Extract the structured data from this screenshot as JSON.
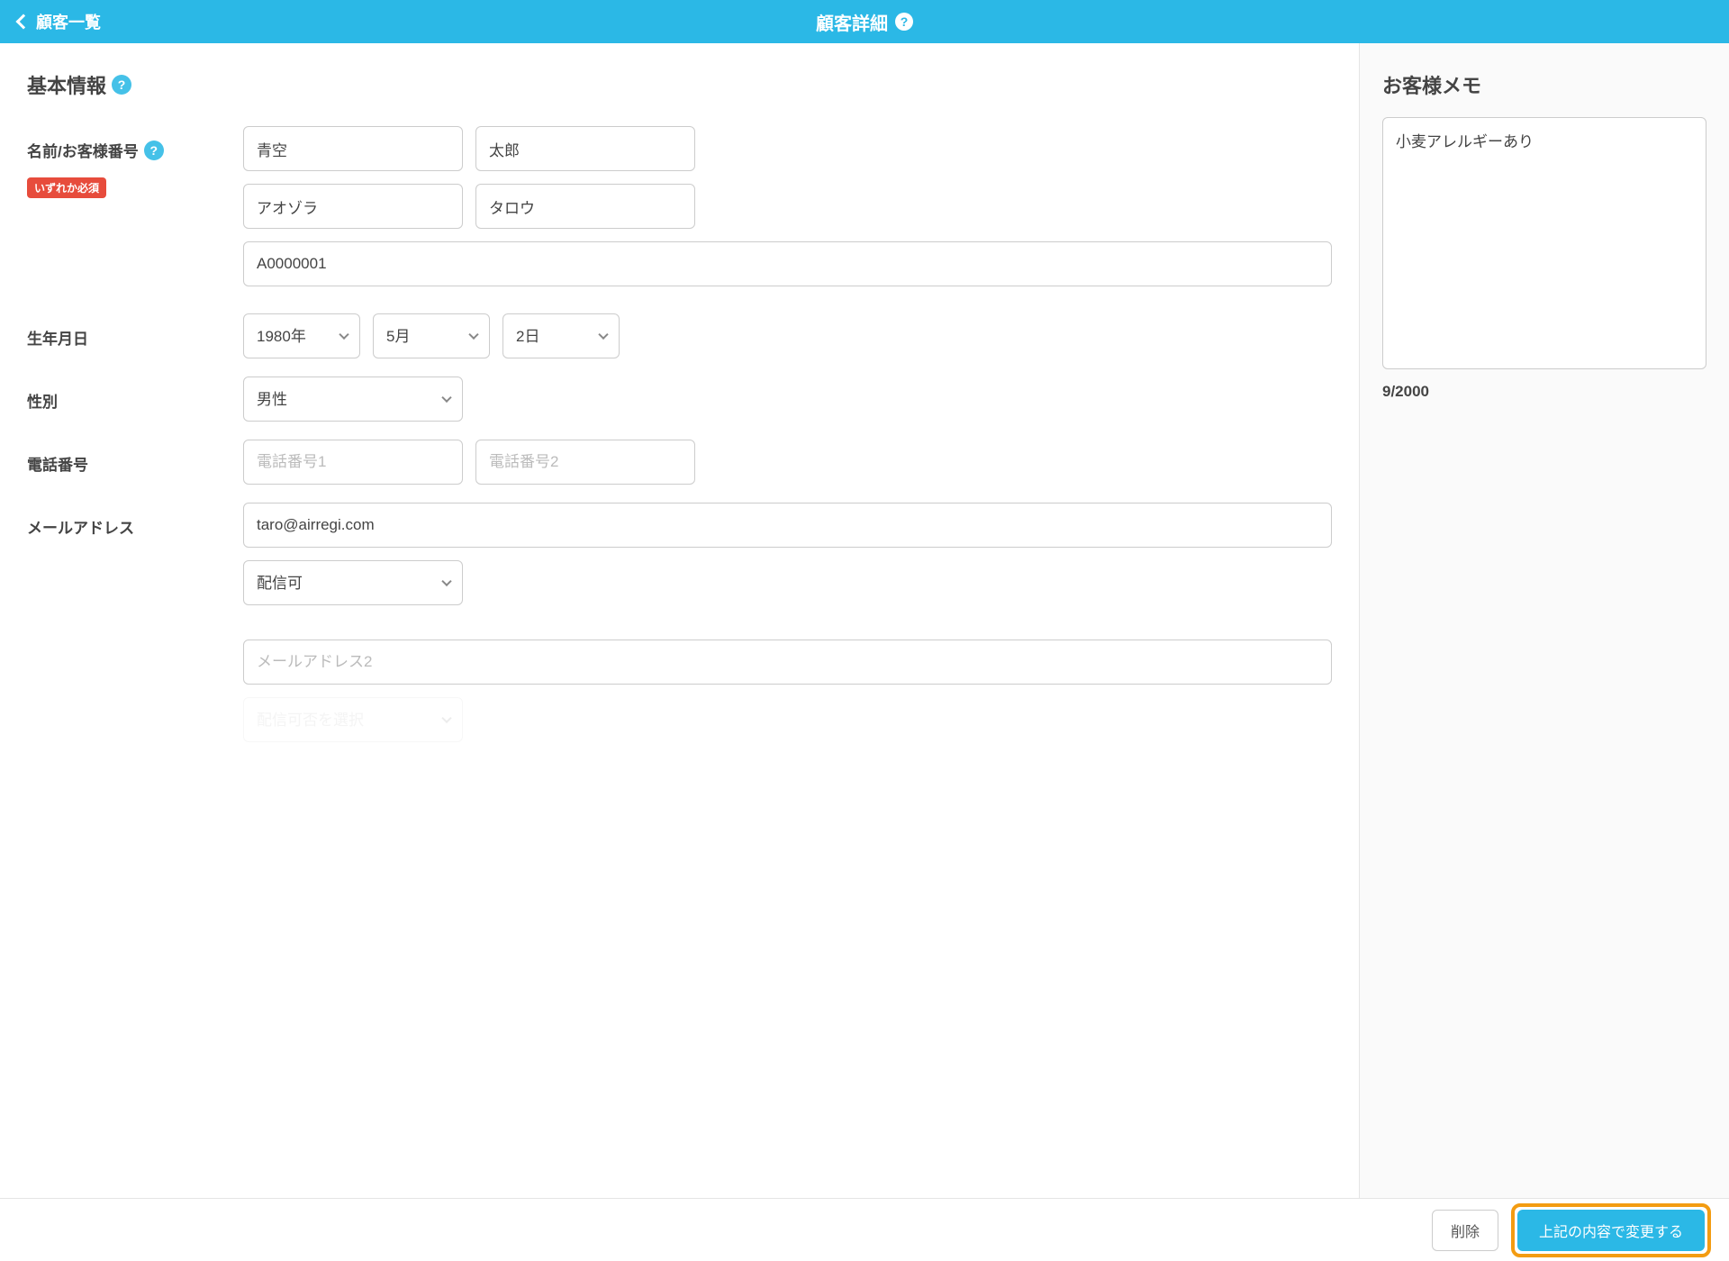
{
  "header": {
    "back_label": "顧客一覧",
    "title": "顧客詳細"
  },
  "basic_info": {
    "section_title": "基本情報",
    "name_label": "名前/お客様番号",
    "required_badge": "いずれか必須",
    "surname": "青空",
    "given_name": "太郎",
    "surname_kana": "アオゾラ",
    "given_name_kana": "タロウ",
    "customer_number": "A0000001",
    "birthday_label": "生年月日",
    "year": "1980年",
    "month": "5月",
    "day": "2日",
    "gender_label": "性別",
    "gender": "男性",
    "phone_label": "電話番号",
    "phone1_placeholder": "電話番号1",
    "phone2_placeholder": "電話番号2",
    "email_label": "メールアドレス",
    "email1": "taro@airregi.com",
    "delivery1": "配信可",
    "email2_placeholder": "メールアドレス2",
    "delivery2_placeholder": "配信可否を選択"
  },
  "memo": {
    "title": "お客様メモ",
    "content": "小麦アレルギーあり",
    "counter": "9/2000"
  },
  "footer": {
    "delete_label": "削除",
    "save_label": "上記の内容で変更する"
  }
}
